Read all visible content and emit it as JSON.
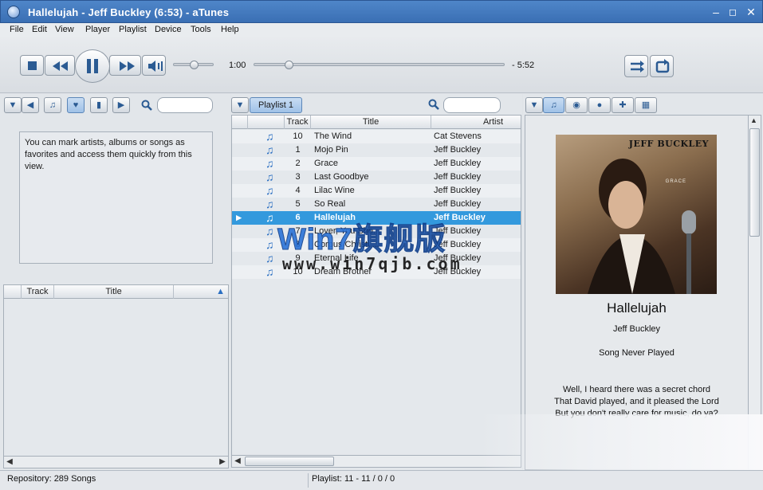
{
  "window": {
    "title": "Hallelujah - Jeff Buckley (6:53) - aTunes"
  },
  "menu": [
    "File",
    "Edit",
    "View",
    "Player",
    "Playlist",
    "Device",
    "Tools",
    "Help"
  ],
  "player": {
    "elapsed": "1:00",
    "remaining": "- 5:52",
    "progress_fraction": 0.14,
    "volume_fraction": 0.5
  },
  "left_panel": {
    "info": "You can mark artists, albums or songs as favorites and access them quickly from this view.",
    "columns": [
      "Track",
      "Title"
    ]
  },
  "playlist": {
    "tab_label": "Playlist 1",
    "columns": [
      "Track",
      "Title",
      "Artist"
    ],
    "rows": [
      {
        "track": "10",
        "title": "The Wind",
        "artist": "Cat Stevens"
      },
      {
        "track": "1",
        "title": "Mojo Pin",
        "artist": "Jeff Buckley"
      },
      {
        "track": "2",
        "title": "Grace",
        "artist": "Jeff Buckley"
      },
      {
        "track": "3",
        "title": "Last Goodbye",
        "artist": "Jeff Buckley"
      },
      {
        "track": "4",
        "title": "Lilac Wine",
        "artist": "Jeff Buckley"
      },
      {
        "track": "5",
        "title": "So Real",
        "artist": "Jeff Buckley"
      },
      {
        "track": "6",
        "title": "Hallelujah",
        "artist": "Jeff Buckley"
      },
      {
        "track": "7",
        "title": "Lover, You Sho...",
        "artist": "Jeff Buckley"
      },
      {
        "track": "8",
        "title": "Corpus Christi ...",
        "artist": "Jeff Buckley"
      },
      {
        "track": "9",
        "title": "Eternal Life",
        "artist": "Jeff Buckley"
      },
      {
        "track": "10",
        "title": "Dream Brother",
        "artist": "Jeff Buckley"
      }
    ],
    "playing_index": 6
  },
  "context": {
    "album_cover_title": "JEFF BUCKLEY",
    "album_cover_sub": "GRACE",
    "song_title": "Hallelujah",
    "artist": "Jeff Buckley",
    "play_status": "Song Never Played",
    "lyrics": [
      "Well, I heard there was a secret chord",
      "That David played, and it pleased the Lord",
      "But you don't really care for music, do ya?"
    ]
  },
  "status": {
    "repository": "Repository: 289 Songs",
    "playlist": "Playlist: 11 - 11 / 0 / 0"
  },
  "watermark": {
    "line1": "Win7旗舰版",
    "line2": "www.win7qjb.com"
  },
  "colors": {
    "selection": "#3399dd",
    "accent": "#2b5b93"
  }
}
